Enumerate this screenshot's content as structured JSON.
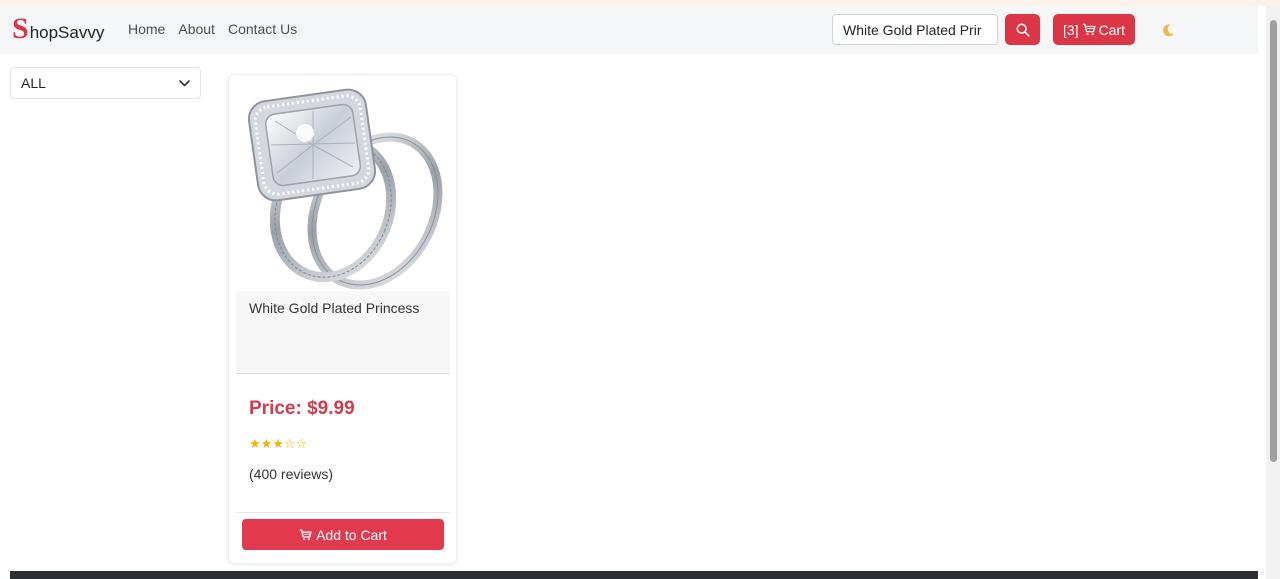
{
  "brand": {
    "initial": "S",
    "rest": "hopSavvy"
  },
  "nav": {
    "links": [
      "Home",
      "About",
      "Contact Us"
    ]
  },
  "search": {
    "value": "White Gold Plated Prir"
  },
  "cart": {
    "count_label": "[3]",
    "label": "Cart"
  },
  "filter": {
    "selected": "ALL"
  },
  "product": {
    "title": "White Gold Plated Princess",
    "price": "Price: $9.99",
    "rating": 3,
    "rating_max": 5,
    "reviews": "(400 reviews)",
    "add_to_cart_label": "Add to Cart"
  },
  "colors": {
    "accent": "#dc3545",
    "star": "#f0b400",
    "footer": "#2b2f33"
  },
  "icons": [
    "search-icon",
    "cart-icon",
    "moon-icon",
    "chevron-down-icon"
  ]
}
